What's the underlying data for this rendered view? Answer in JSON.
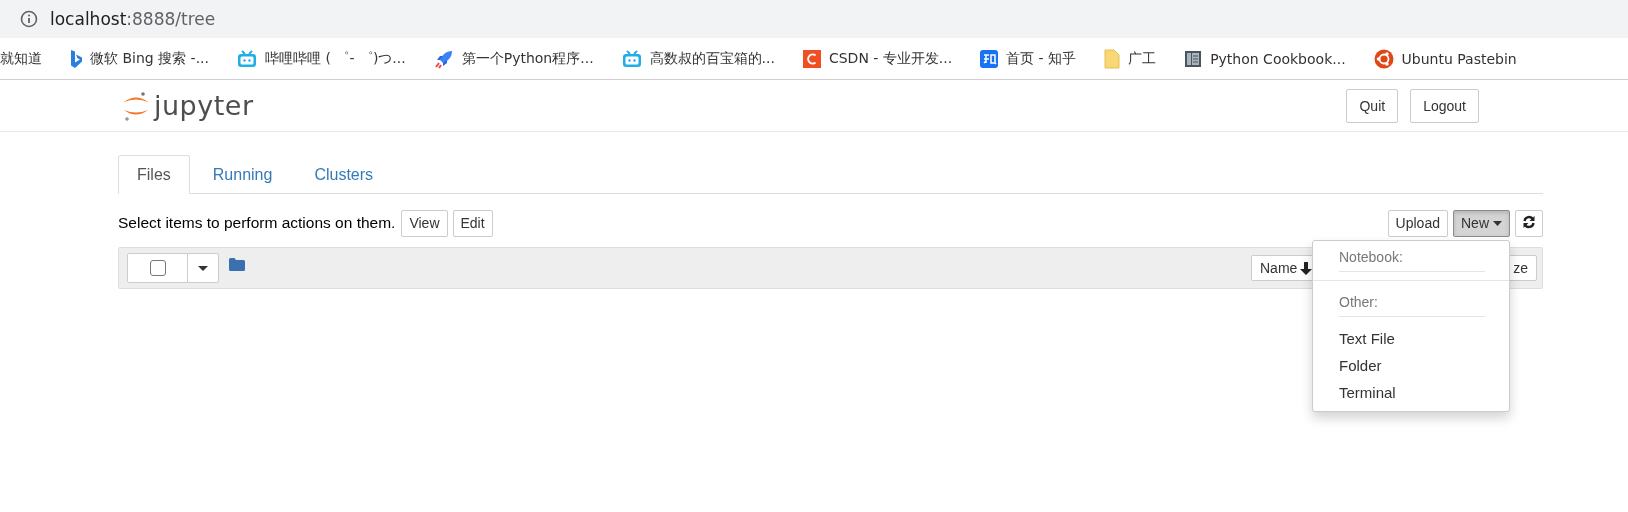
{
  "address_bar": {
    "host": "localhost",
    "path": ":8888/tree"
  },
  "bookmarks": [
    {
      "label": "就知道",
      "kind": "plain"
    },
    {
      "label": "微软 Bing 搜索 -...",
      "kind": "bing"
    },
    {
      "label": "哔哩哔哩 ( ゜- ゜)つ...",
      "kind": "bilibili"
    },
    {
      "label": "第一个Python程序...",
      "kind": "rocket"
    },
    {
      "label": "高数叔的百宝箱的...",
      "kind": "bilibili"
    },
    {
      "label": "CSDN - 专业开发...",
      "kind": "csdn"
    },
    {
      "label": "首页 - 知乎",
      "kind": "zhihu"
    },
    {
      "label": "广工",
      "kind": "folder"
    },
    {
      "label": "Python Cookbook...",
      "kind": "book"
    },
    {
      "label": "Ubuntu Pastebin",
      "kind": "ubuntu"
    }
  ],
  "header": {
    "logo": "jupyter",
    "buttons": [
      "Quit",
      "Logout"
    ]
  },
  "tabs": [
    {
      "label": "Files",
      "selected": true
    },
    {
      "label": "Running",
      "selected": false
    },
    {
      "label": "Clusters",
      "selected": false
    }
  ],
  "toolbar": {
    "hint": "Select items to perform actions on them.",
    "left_buttons": [
      "View",
      "Edit"
    ],
    "upload": "Upload",
    "new": {
      "label": "New",
      "open": true
    }
  },
  "list_header": {
    "select_all_checked": false,
    "sort_name": "Name",
    "sort_other": "ze"
  },
  "new_menu": {
    "sections": [
      {
        "header": "Notebook:"
      },
      {
        "header": "Other:",
        "items": [
          "Text File",
          "Folder",
          "Terminal"
        ]
      }
    ]
  }
}
